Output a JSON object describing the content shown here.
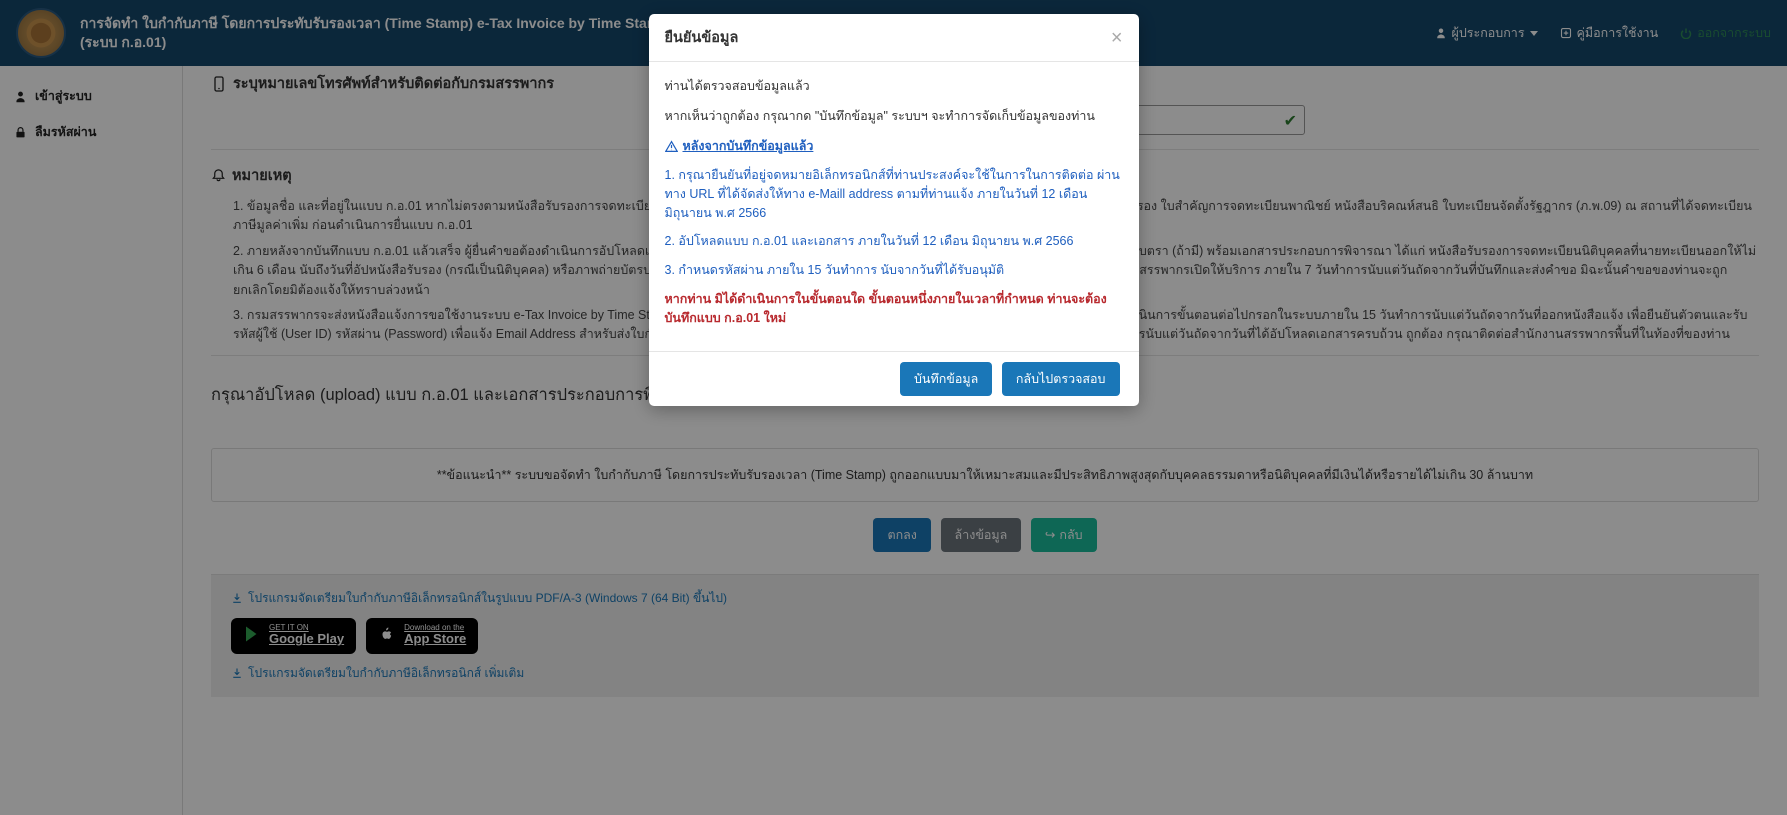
{
  "header": {
    "title_line1": "การจัดทำ ใบกำกับภาษี โดยการประทับรับรองเวลา (Time Stamp) e-Tax Invoice by Time Stamp",
    "title_line2": "(ระบบ ก.อ.01)",
    "links": {
      "user": "ผู้ประกอบการ",
      "manual": "คู่มือการใช้งาน",
      "logout": "ออกจากระบบ"
    }
  },
  "sidebar": {
    "login": "เข้าสู่ระบบ",
    "forgot": "ลืมรหัสผ่าน"
  },
  "main": {
    "phone_section_title": "ระบุหมายเลขโทรศัพท์สำหรับติดต่อกับกรมสรรพากร",
    "phone_value": "",
    "notes_heading": "หมายเหตุ",
    "note1": "1. ข้อมูลชื่อ และที่อยู่ในแบบ ก.อ.01 หากไม่ตรงตามหนังสือรับรองการจดทะเบียนนิติบุคคล ให้ยื่นแบบ ภ.พ.09 พร้อมหลักฐานที่กรมพัฒนาธุรกิจการค้าออกให้ เช่น หนังสือรับรอง ใบสำคัญการจดทะเบียนพาณิชย์ หนังสือบริคณห์สนธิ ใบทะเบียนจัดตั้งรัฐฎากร (ภ.พ.09) ณ สถานที่ได้จดทะเบียนภาษีมูลค่าเพิ่ม ก่อนดำเนินการยื่นแบบ ก.อ.01",
    "note2": "2. ภายหลังจากบันทึกแบบ ก.อ.01 แล้วเสร็จ ผู้ยื่นคำขอต้องดำเนินการอัปโหลดเอกสาร ได้แก่ แบบ ก.อ.01 ที่ลงนามโดยผู้มีอำนาจลงนาม (ห้างหุ้นส่วน/กรรมการ) พร้อมประทับตรา (ถ้ามี) พร้อมเอกสารประกอบการพิจารณา ได้แก่ หนังสือรับรองการจดทะเบียนนิติบุคคลที่นายทะเบียนออกให้ไม่เกิน 6 เดือน นับถึงวันที่อัปหนังสือรับรอง (กรณีเป็นนิติบุคคล) หรือภาพถ่ายบัตรประจำตัวประชาชน (กรณีเป็นบุคคลธรรมดา) ทั้งนี้ การอัปโหลดสามารถดำเนินการได้เมื่อกรมสรรพากรเปิดให้บริการ ภายใน 7 วันทำการนับแต่วันถัดจากวันที่บันทึกและส่งคำขอ มิฉะนั้นคำขอของท่านจะถูกยกเลิกโดยมิต้องแจ้งให้ทราบล่วงหน้า",
    "note3": "3. กรมสรรพากรจะส่งหนังสือแจ้งการขอใช้งานระบบ e-Tax Invoice by Time Stamp ไปยัง e-Mail address ที่ท่านแจ้งไว้ เมื่อได้รับหนังสือแจ้งให้ท่านล็อกอินเข้าระบบเพื่อดำเนินการขั้นตอนต่อไปกรอกในระบบภายใน 15 วันทำการนับแต่วันถัดจากวันที่ออกหนังสือแจ้ง เพื่อยืนยันตัวตนและรับรหัสผู้ใช้ (User ID) รหัสผ่าน (Password) เพื่อแจ้ง Email Address สำหรับส่งใบกำกับภาษีอิเล็กทรอนิกส์ พร้อมทั้งกำหนดรหัสผ่าน (Password) ด้วยตนเอง ภายใน 15 วันทำการนับแต่วันถัดจากวันที่ได้อัปโหลดเอกสารครบถ้วน ถูกต้อง กรุณาติดต่อสำนักงานสรรพากรพื้นที่ในท้องที่ของท่าน",
    "upload_title": "กรุณาอัปโหลด (upload) แบบ ก.อ.01 และเอกสารประกอบการพิจารณา ภายในวันที่ 12 เดือน มิถุนายน พ.ศ 2566",
    "advice": "**ข้อแนะนำ** ระบบขอจัดทำ ใบกำกับภาษี โดยการประทับรับรองเวลา (Time Stamp) ถูกออกแบบมาให้เหมาะสมและมีประสิทธิภาพสูงสุดกับบุคคลธรรมดาหรือนิติบุคคลที่มีเงินได้หรือรายได้ไม่เกิน 30 ล้านบาท",
    "actions": {
      "submit": "ตกลง",
      "clear": "ล้างข้อมูล",
      "back": "กลับ"
    },
    "download1": "โปรแกรมจัดเตรียมใบกำกับภาษีอิเล็กทรอนิกส์ในรูปแบบ PDF/A-3 (Windows 7 (64 Bit) ขึ้นไป)",
    "store_google_small": "GET IT ON",
    "store_google_big": "Google Play",
    "store_apple_small": "Download on the",
    "store_apple_big": "App Store",
    "download2": "โปรแกรมจัดเตรียมใบกำกับภาษีอิเล็กทรอนิกส์ เพิ่มเติม"
  },
  "modal": {
    "title": "ยืนยันข้อมูล",
    "p1": "ท่านได้ตรวจสอบข้อมูลแล้ว",
    "p2": "หากเห็นว่าถูกต้อง กรุณากด \"บันทึกข้อมูล\" ระบบฯ จะทำการจัดเก็บข้อมูลของท่าน",
    "after_link": "หลังจากบันทึกข้อมูลแล้ว",
    "b1": "1. กรุณายืนยันที่อยู่จดหมายอิเล็กทรอนิกส์ที่ท่านประสงค์จะใช้ในการในการติดต่อ ผ่านทาง URL ที่ได้จัดส่งให้ทาง e-Maill address ตามที่ท่านแจ้ง ภายในวันที่ 12 เดือน มิถุนายน พ.ศ 2566",
    "b2": "2. อัปโหลดแบบ ก.อ.01 และเอกสาร ภายในวันที่ 12 เดือน มิถุนายน พ.ศ 2566",
    "b3": "3. กำหนดรหัสผ่าน ภายใน 15 วันทำการ นับจากวันที่ได้รับอนุมัติ",
    "warn": "หากท่าน มิได้ดำเนินการในขั้นตอนใด ขั้นตอนหนึ่งภายในเวลาที่กำหนด ท่านจะต้องบันทึกแบบ ก.อ.01 ใหม่",
    "save": "บันทึกข้อมูล",
    "back": "กลับไปตรวจสอบ"
  }
}
